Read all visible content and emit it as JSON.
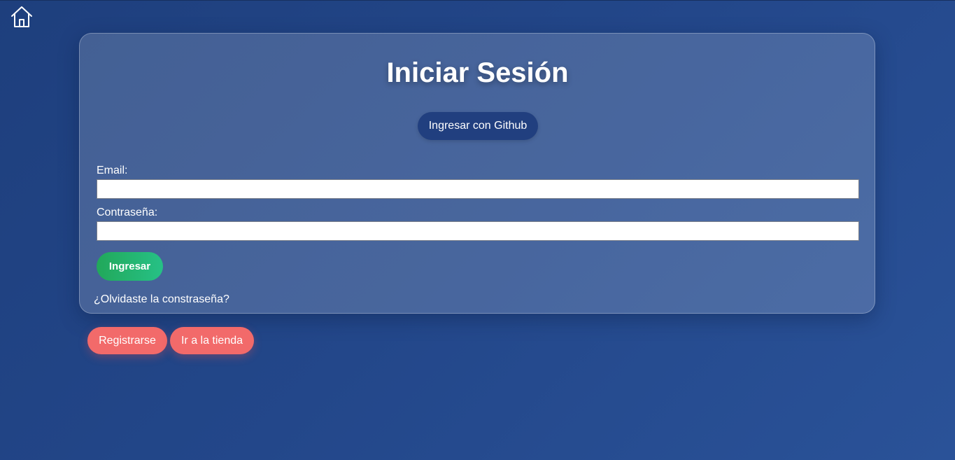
{
  "header": {
    "home_icon": "home-icon"
  },
  "login": {
    "title": "Iniciar Sesión",
    "github_label": "Ingresar con Github",
    "email_label": "Email:",
    "email_value": "",
    "password_label": "Contraseña:",
    "password_value": "",
    "submit_label": "Ingresar",
    "forgot_label": "¿Olvidaste la constraseña?"
  },
  "actions": {
    "register_label": "Registrarse",
    "store_label": "Ir a la tienda"
  },
  "colors": {
    "background": "#23478a",
    "github_button": "#213f7f",
    "submit_button": "#22a85a",
    "secondary_button": "#f26a6a"
  }
}
